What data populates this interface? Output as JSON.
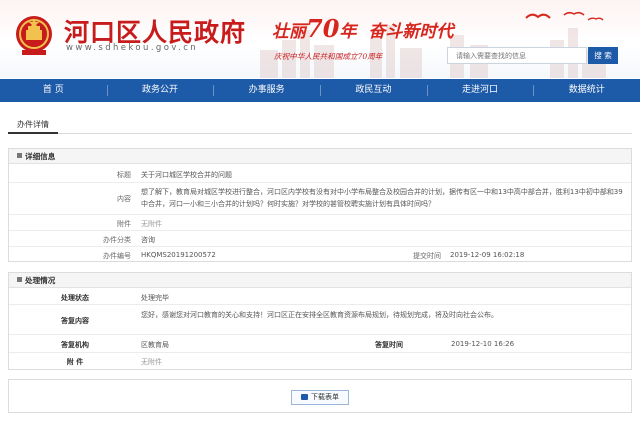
{
  "header": {
    "title": "河口区人民政府",
    "domain": "www.sdhekou.gov.cn",
    "slogan_a": "壮丽",
    "slogan_num": "70",
    "slogan_b": "年",
    "slogan_c": "奋斗新时代",
    "slogan_sub": "庆祝中华人民共和国成立70周年",
    "search_placeholder": "请输入需要查找的信息",
    "search_button": "搜 索"
  },
  "nav": [
    "首 页",
    "政务公开",
    "办事服务",
    "政民互动",
    "走进河口",
    "数据统计"
  ],
  "page_tab": "办件详情",
  "detail": {
    "title": "详细信息",
    "labels": {
      "subject": "标题",
      "content": "内容",
      "attachment": "附件",
      "category": "办件分类",
      "number": "办件编号",
      "submit_time": "提交时间"
    },
    "values": {
      "subject": "关于河口城区学校合并的问题",
      "content": "想了解下，教育局对城区学校进行整合，河口区内学校有没有对中小学布局整合及校园合并的计划，据传有区一中和13中高中部合并，胜利13中初中部和39中合井，河口一小和三小合并的计划吗？何时实施？对学校的甚管校聘实施计划有具体时间吗？",
      "attachment": "无附件",
      "category": "咨询",
      "number": "HKQMS20191200572",
      "submit_time": "2019-12-09 16:02:18"
    }
  },
  "handling": {
    "title": "处理情况",
    "labels": {
      "status": "处理状态",
      "reply": "答复内容",
      "org": "答复机构",
      "reply_time": "答复时间",
      "attachment": "附 件"
    },
    "values": {
      "status": "处理完毕",
      "reply": "您好，感谢您对河口教育的关心和支持！河口区正在安排全区教育资源布局规划，待规划完成，将及时向社会公布。",
      "org": "区教育局",
      "reply_time": "2019-12-10 16:26",
      "attachment": "无附件"
    }
  },
  "download_button": "下载表单",
  "colors": {
    "brand_blue": "#1d5aa7",
    "brand_red": "#c81b1b"
  }
}
